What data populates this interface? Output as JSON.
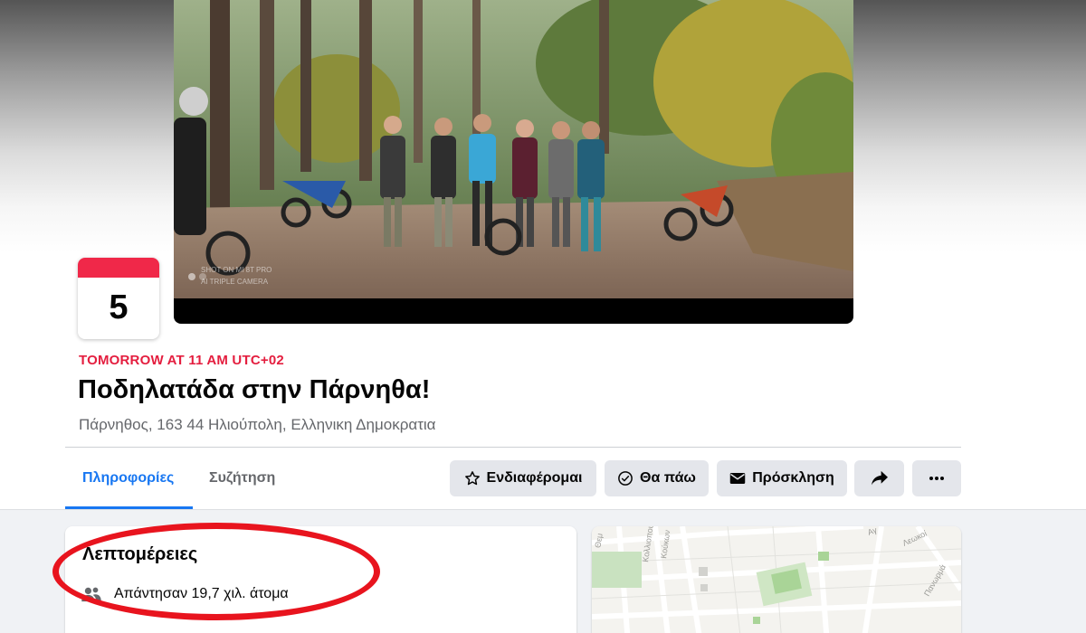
{
  "cover": {
    "watermark_line1": "SHOT ON MI 8T PRO",
    "watermark_line2": "AI TRIPLE CAMERA"
  },
  "event": {
    "day": "5",
    "when": "TOMORROW AT 11 AM UTC+02",
    "title": "Ποδηλατάδα στην Πάρνηθα!",
    "location": "Πάρνηθος, 163 44 Ηλιούπολη, Ελληνικη Δημοκρατια"
  },
  "tabs": [
    {
      "label": "Πληροφορίες",
      "active": true
    },
    {
      "label": "Συζήτηση",
      "active": false
    }
  ],
  "actions": {
    "interested": "Ενδιαφέρομαι",
    "going": "Θα πάω",
    "invite": "Πρόσκληση",
    "share_icon": "share-icon",
    "more_icon": "more-icon"
  },
  "details": {
    "title": "Λεπτομέρειες",
    "responded": "Απάντησαν 19,7 χιλ. άτομα"
  },
  "map": {
    "street_labels": [
      "Θεμ",
      "Κολλιοπουλου",
      "Κούκων",
      "Αγ",
      "Λεωκοί",
      "Πανωρμά"
    ]
  },
  "colors": {
    "accent": "#1877f2",
    "event_red": "#e41e3f",
    "annotation": "#e8141e"
  }
}
